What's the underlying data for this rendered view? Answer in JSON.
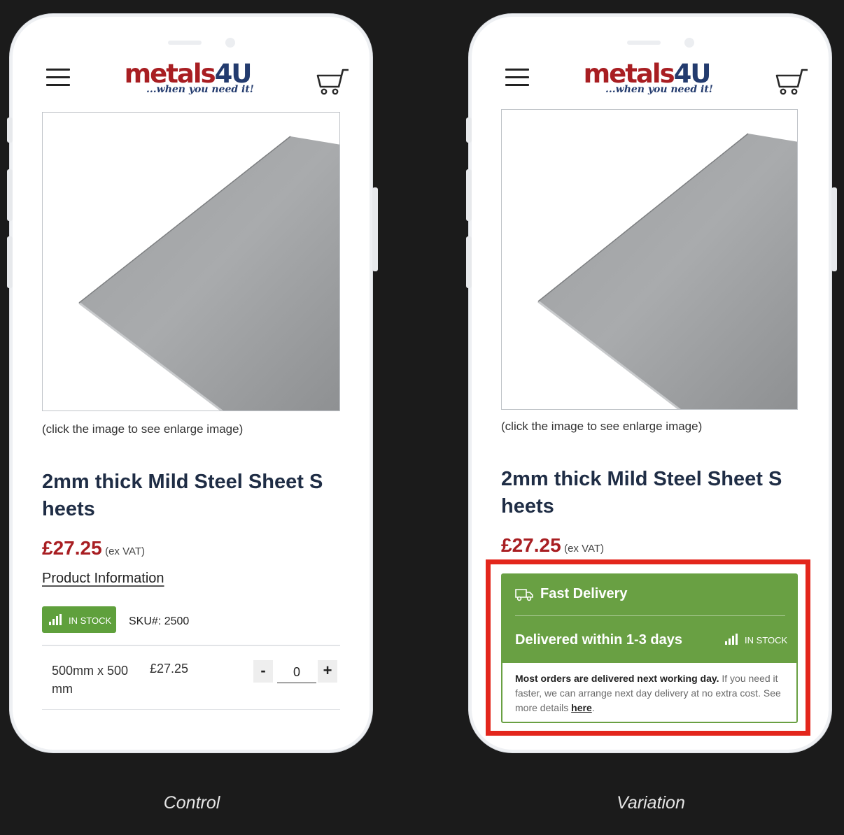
{
  "control": {
    "logo": {
      "brand_metals": "metals",
      "brand_4u": "4U",
      "tagline": "...when you need it!"
    },
    "image_hint": "(click the image to see enlarge image)",
    "product_title": "2mm thick Mild Steel Sheet S heets",
    "price": "£27.25",
    "price_note": "(ex VAT)",
    "product_info_link": "Product Information",
    "stock_badge": "IN STOCK",
    "sku": "SKU#: 2500",
    "variant_row": {
      "size": "500mm x 500 mm",
      "price": "£27.25",
      "qty_minus": "-",
      "qty_value": "0",
      "qty_plus": "+"
    },
    "caption": "Control"
  },
  "variation": {
    "logo": {
      "brand_metals": "metals",
      "brand_4u": "4U",
      "tagline": "...when you need it!"
    },
    "image_hint": "(click the image to see enlarge image)",
    "product_title": "2mm thick Mild Steel Sheet S heets",
    "price": "£27.25",
    "price_note": "(ex VAT)",
    "delivery": {
      "title": "Fast Delivery",
      "subtitle": "Delivered within 1-3 days",
      "stock": "IN STOCK",
      "text_bold": "Most orders are delivered next working day.",
      "text_rest": " If you need it faster, we can arrange next day delivery at no extra cost. See more details ",
      "link": "here",
      "tail": "."
    },
    "caption": "Variation"
  },
  "colors": {
    "brand_red": "#a81e22",
    "brand_navy": "#233b6e",
    "stock_green": "#5fa03c",
    "delivery_green": "#69a043",
    "highlight_red": "#e3261c",
    "background": "#1b1b1b"
  },
  "icons": [
    "menu-icon",
    "cart-icon",
    "signal-bars-icon",
    "truck-icon"
  ]
}
